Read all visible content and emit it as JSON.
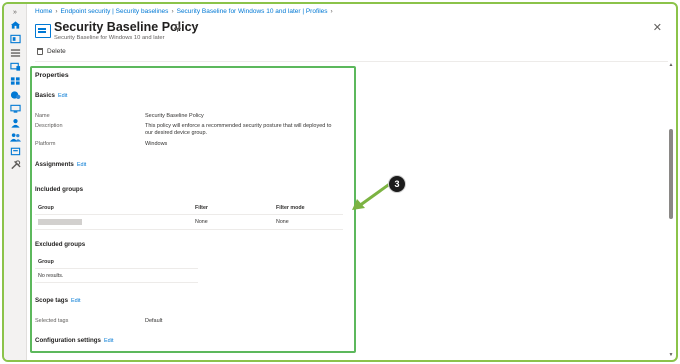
{
  "breadcrumb": [
    "Home",
    "Endpoint security | Security baselines",
    "Security Baseline for Windows 10 and later | Profiles"
  ],
  "header": {
    "title": "Security Baseline Policy",
    "subtitle": "Security Baseline for Windows 10 and later",
    "more": "···",
    "close": "✕"
  },
  "toolbar": {
    "delete_label": "Delete"
  },
  "properties": {
    "heading": "Properties",
    "basics": {
      "heading": "Basics",
      "edit": "Edit",
      "name_label": "Name",
      "name_value": "Security Baseline Policy",
      "description_label": "Description",
      "description_line1": "This policy will enforce a recommended security posture that will deployed to",
      "description_line2": "our desired device group.",
      "platform_label": "Platform",
      "platform_value": "Windows"
    },
    "assignments": {
      "heading": "Assignments",
      "edit": "Edit"
    },
    "included_groups": {
      "heading": "Included groups",
      "columns": [
        "Group",
        "Filter",
        "Filter mode"
      ],
      "row": {
        "filter": "None",
        "filter_mode": "None"
      }
    },
    "excluded_groups": {
      "heading": "Excluded groups",
      "column": "Group",
      "empty": "No results."
    },
    "scope_tags": {
      "heading": "Scope tags",
      "edit": "Edit",
      "label": "Selected tags",
      "value": "Default"
    },
    "configuration": {
      "heading": "Configuration settings",
      "edit": "Edit"
    }
  },
  "callout": {
    "number": "3"
  },
  "sidebar_icons": [
    "collapse-icon",
    "home-icon",
    "dashboard-icon",
    "all-services-icon",
    "devices-icon",
    "apps-icon",
    "endpoint-security-icon",
    "reports-icon",
    "users-icon",
    "groups-icon",
    "tenant-admin-icon",
    "troubleshoot-icon"
  ],
  "colors": {
    "accent": "#0078d4",
    "frame": "#8bc34a",
    "highlight": "#5cb85c",
    "arrow": "#7cb342"
  }
}
